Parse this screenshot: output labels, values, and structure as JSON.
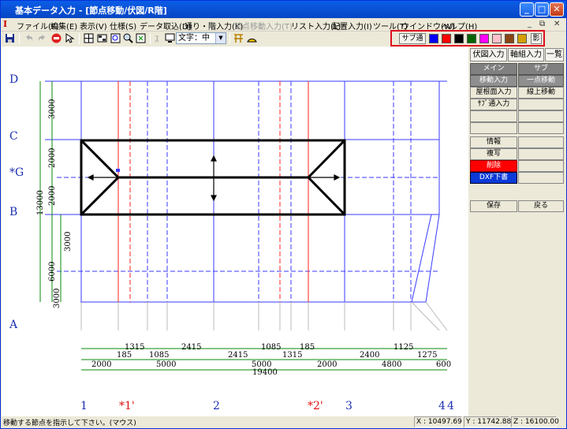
{
  "window": {
    "title": "基本データ入力 - [節点移動/伏図/R階]"
  },
  "menu": {
    "items": [
      {
        "label": "ファイル(F)",
        "enabled": true
      },
      {
        "label": "編集(E)",
        "enabled": true
      },
      {
        "label": "表示(V)",
        "enabled": true
      },
      {
        "label": "仕様(S)",
        "enabled": true
      },
      {
        "label": "データ取込(D)",
        "enabled": true
      },
      {
        "label": "通り・階入力(K)",
        "enabled": true
      },
      {
        "label": "節点移動入力(T)",
        "enabled": false
      },
      {
        "label": "リスト入力(L)",
        "enabled": true
      },
      {
        "label": "配置入力(I)",
        "enabled": true
      },
      {
        "label": "ツール(T)",
        "enabled": true
      },
      {
        "label": "ウインドウ(W)",
        "enabled": true
      },
      {
        "label": "ヘルプ(H)",
        "enabled": true
      }
    ]
  },
  "toolbar": {
    "font_select": "文字：中"
  },
  "palette": {
    "sub_label": "サブ通",
    "shadow_label": "影",
    "colors": [
      "#0000ff",
      "#ff0000",
      "#000000",
      "#006400",
      "#ff00ff",
      "#ffc0cb",
      "#8b4513",
      "#d4a000"
    ]
  },
  "right_panel": {
    "tabs": [
      "伏図入力",
      "軸組入力",
      "一覧"
    ],
    "main_header": "メイン",
    "sub_header": "サブ",
    "main_buttons": [
      "移動入力",
      "屋根面入力",
      "ｻﾌﾞ通入力",
      "",
      "",
      "情報",
      "複写",
      "削除",
      "DXF下書"
    ],
    "sub_buttons": [
      "一点移動",
      "線上移動",
      "",
      "",
      "",
      "",
      "",
      "",
      ""
    ],
    "save": "保存",
    "back": "戻る"
  },
  "drawing": {
    "row_labels": [
      "D",
      "C",
      "*G",
      "B",
      "A"
    ],
    "col_labels": [
      "1",
      "*1'",
      "2",
      "*2'",
      "3",
      "4",
      "4"
    ],
    "dims_row1": [
      "185",
      "1315",
      "1085",
      "2415",
      "2415",
      "1085",
      "1315",
      "185",
      "2400",
      "1125",
      "1275"
    ],
    "dims_row2": [
      "2000",
      "5000",
      "5000",
      "2000",
      "4800",
      "600"
    ],
    "dims_total": "19400",
    "dims_left_upper": [
      "3000",
      "2000",
      "2000"
    ],
    "dims_left_lower": [
      "3000",
      "6000",
      "3000"
    ],
    "dims_left_total": "13000"
  },
  "status": {
    "message": "移動する節点を指示して下さい。(マウス)",
    "x": "X : 10497.69",
    "y": "Y : 11742.88",
    "z": "Z : 16100.00"
  }
}
